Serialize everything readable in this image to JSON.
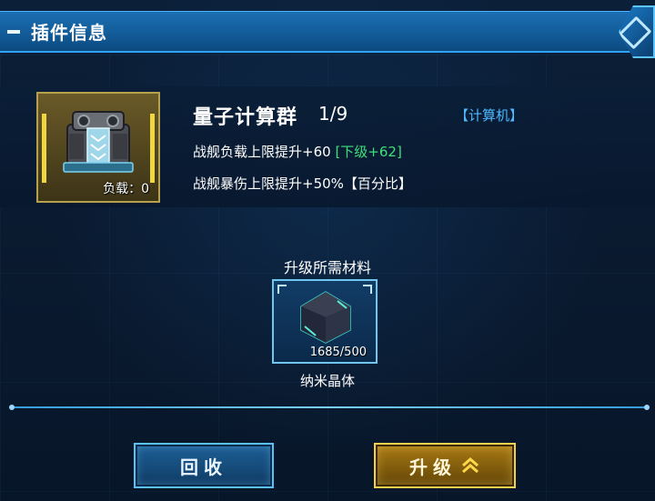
{
  "window": {
    "title": "插件信息"
  },
  "plugin": {
    "name": "量子计算群",
    "level": "1/9",
    "type": "【计算机】",
    "load": "负载：0",
    "stat1_prefix": "战舰负载上限提升+60 ",
    "stat1_next": "[下级+62]",
    "stat2": "战舰暴伤上限提升+50%【百分比】",
    "icon": "quantum-computer-icon"
  },
  "materials": {
    "title": "升级所需材料",
    "items": [
      {
        "name": "纳米晶体",
        "count": "1685/500",
        "icon": "nano-crystal-icon"
      }
    ]
  },
  "buttons": {
    "recycle": "回收",
    "upgrade": "升级"
  },
  "colors": {
    "accent": "#2fa3ff",
    "next_level": "#3fe07a",
    "type_tag": "#4fb8ff",
    "upgrade_gold": "#f3cf4e"
  }
}
